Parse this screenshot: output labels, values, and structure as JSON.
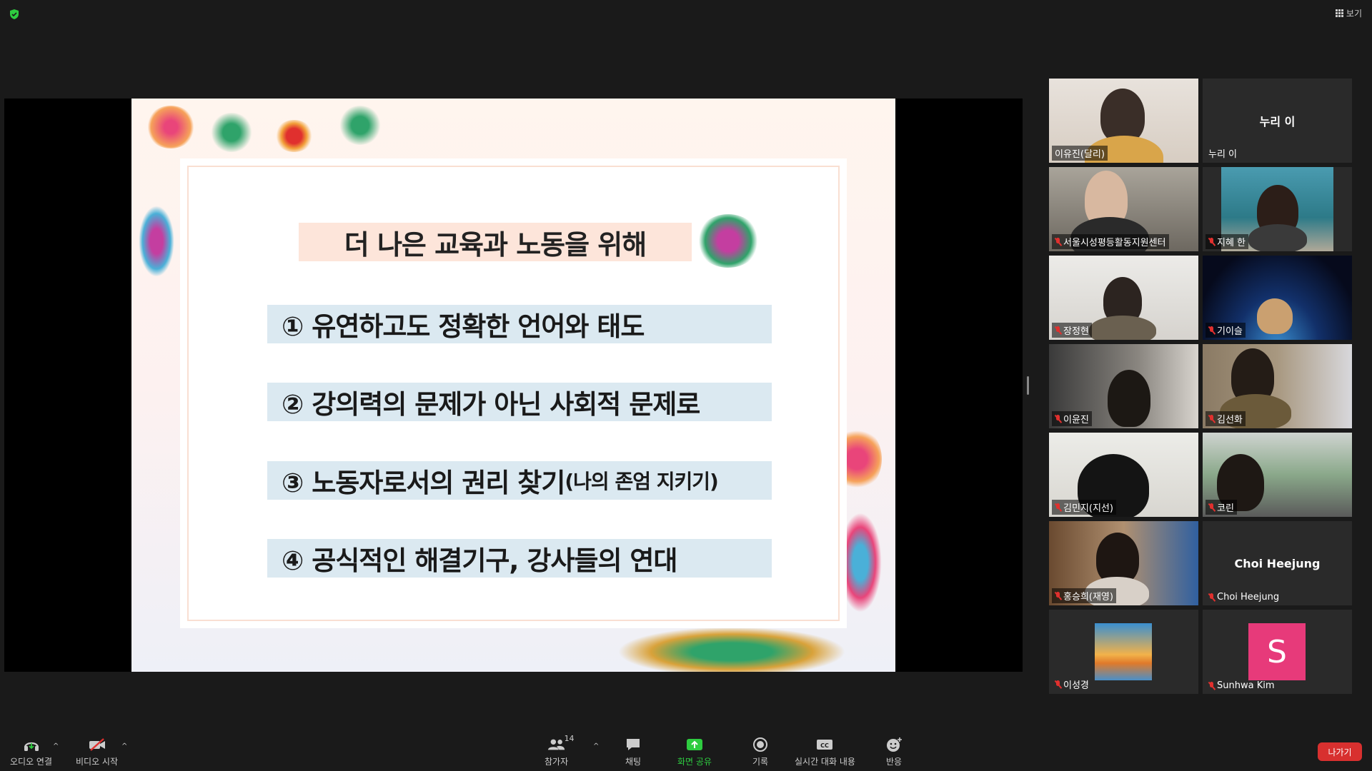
{
  "top": {
    "view_label": "보기"
  },
  "slide": {
    "title": "더 나은 교육과 노동을 위해",
    "items": [
      {
        "main": "① 유연하고도 정확한 언어와 태도",
        "sub": ""
      },
      {
        "main": "② 강의력의 문제가 아닌 사회적 문제로",
        "sub": ""
      },
      {
        "main": "③ 노동자로서의 권리 찾기",
        "sub": "(나의 존엄 지키기)"
      },
      {
        "main": "④ 공식적인 해결기구, 강사들의 연대",
        "sub": ""
      }
    ]
  },
  "participants": [
    {
      "name": "이유진(달리)",
      "muted": false,
      "type": "video",
      "active": true
    },
    {
      "name": "누리 이",
      "muted": false,
      "type": "name",
      "center": "누리 이"
    },
    {
      "name": "서울시성평등활동지원센터",
      "muted": true,
      "type": "video"
    },
    {
      "name": "지혜 한",
      "muted": true,
      "type": "video"
    },
    {
      "name": "장정현",
      "muted": true,
      "type": "video"
    },
    {
      "name": "기이슬",
      "muted": true,
      "type": "video"
    },
    {
      "name": "이윤진",
      "muted": true,
      "type": "video"
    },
    {
      "name": "김선화",
      "muted": true,
      "type": "video"
    },
    {
      "name": "김민지(지선)",
      "muted": true,
      "type": "video"
    },
    {
      "name": "코린",
      "muted": true,
      "type": "video"
    },
    {
      "name": "홍승희(재영)",
      "muted": true,
      "type": "video"
    },
    {
      "name": "Choi Heejung",
      "muted": true,
      "type": "name",
      "center": "Choi Heejung"
    },
    {
      "name": "이성경",
      "muted": true,
      "type": "image"
    },
    {
      "name": "Sunhwa Kim",
      "muted": true,
      "type": "letter",
      "letter": "S"
    }
  ],
  "toolbar": {
    "audio": "오디오 연결",
    "video": "비디오 시작",
    "participants": "참가자",
    "participants_count": "14",
    "chat": "채팅",
    "share": "화면 공유",
    "record": "기록",
    "captions": "실시간 대화 내용",
    "reactions": "반응",
    "leave": "나가기"
  },
  "colors": {
    "share_green": "#2ecc40",
    "leave_red": "#d8302f",
    "active_border": "#e5e56b",
    "avatar_pink": "#e73a7a"
  }
}
